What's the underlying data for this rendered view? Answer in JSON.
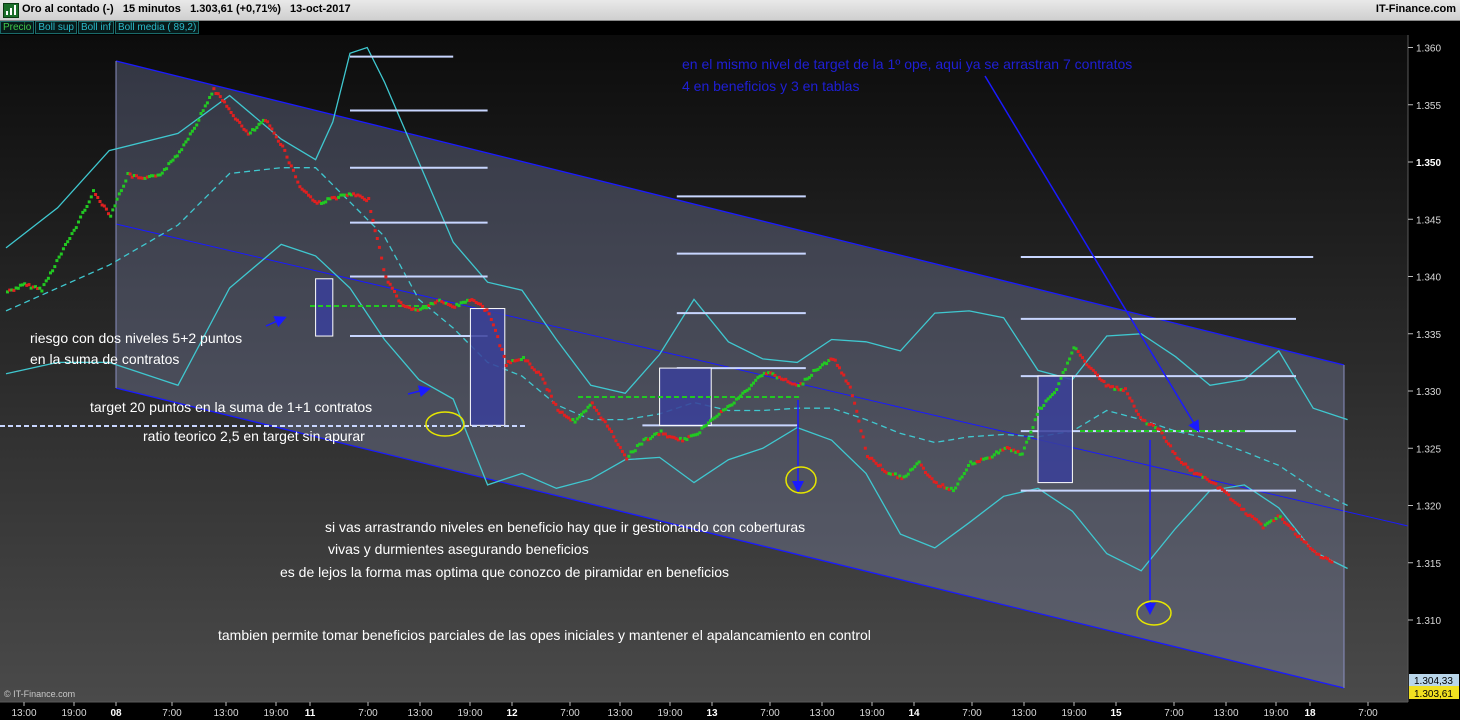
{
  "window": {
    "title": "Oro al contado (-)   15 minutos   1.303,61 (+0,71%)   13-oct-2017",
    "brand": "IT-Finance.com"
  },
  "legend": [
    "Precio",
    "Boll sup",
    "Boll inf",
    "Boll media ( 89,2)"
  ],
  "footer": "© IT-Finance.com",
  "colors": {
    "background": "#000000",
    "bands": "#3fc8d0",
    "channel": "#1a1aff",
    "up": "#22c922",
    "down": "#e02020",
    "levels": "#c8d6ff",
    "boxes": "#3a3f9a",
    "annotation_blue": "#1f1fd6",
    "ellipse": "#e6e600"
  },
  "chart_data": {
    "type": "scatter",
    "title": "Oro al contado (-)",
    "timeframe": "15 minutos",
    "last_price": "1.303,61",
    "change": "+0,71%",
    "date": "13-oct-2017",
    "price_labels": [
      "1.304,33",
      "1.303,61"
    ],
    "yticks": [
      "1.310",
      "1.315",
      "1.320",
      "1.325",
      "1.330",
      "1.335",
      "1.340",
      "1.345",
      "1.350",
      "1.355",
      "1.360"
    ],
    "ylim": [
      1306.5,
      1362
    ],
    "xticks": [
      "13:00",
      "19:00",
      "08",
      "7:00",
      "13:00",
      "19:00",
      "11",
      "7:00",
      "13:00",
      "19:00",
      "12",
      "7:00",
      "13:00",
      "19:00",
      "13",
      "7:00",
      "13:00",
      "19:00",
      "14",
      "7:00",
      "13:00",
      "19:00",
      "15",
      "7:00",
      "13:00",
      "19:00",
      "18",
      "7:00"
    ],
    "xtick_bold": [
      "08",
      "11",
      "12",
      "13",
      "14",
      "15",
      "18"
    ],
    "series": [
      {
        "name": "Precio",
        "points": [
          [
            0,
            1338.8
          ],
          [
            4,
            1339.4
          ],
          [
            8,
            1339.0
          ],
          [
            12,
            1341.8
          ],
          [
            16,
            1344.5
          ],
          [
            20,
            1347.5
          ],
          [
            24,
            1345.5
          ],
          [
            28,
            1349.0
          ],
          [
            32,
            1348.6
          ],
          [
            36,
            1349.2
          ],
          [
            40,
            1351.0
          ],
          [
            44,
            1353.5
          ],
          [
            48,
            1356.5
          ],
          [
            52,
            1354.5
          ],
          [
            56,
            1352.5
          ],
          [
            60,
            1353.8
          ],
          [
            64,
            1351.5
          ],
          [
            68,
            1348.0
          ],
          [
            72,
            1346.5
          ],
          [
            76,
            1347.0
          ],
          [
            80,
            1347.3
          ],
          [
            84,
            1346.8
          ],
          [
            88,
            1340.0
          ],
          [
            92,
            1337.5
          ],
          [
            96,
            1337.2
          ],
          [
            100,
            1338.0
          ],
          [
            104,
            1337.5
          ],
          [
            108,
            1338.2
          ],
          [
            112,
            1337.0
          ],
          [
            116,
            1332.5
          ],
          [
            120,
            1333.0
          ],
          [
            124,
            1331.5
          ],
          [
            128,
            1328.5
          ],
          [
            132,
            1327.4
          ],
          [
            136,
            1329.0
          ],
          [
            140,
            1326.8
          ],
          [
            144,
            1324.3
          ],
          [
            148,
            1325.8
          ],
          [
            152,
            1326.5
          ],
          [
            156,
            1325.8
          ],
          [
            160,
            1326.2
          ],
          [
            164,
            1327.8
          ],
          [
            168,
            1328.8
          ],
          [
            172,
            1330.2
          ],
          [
            176,
            1331.8
          ],
          [
            180,
            1331.2
          ],
          [
            184,
            1330.5
          ],
          [
            188,
            1332.0
          ],
          [
            192,
            1333.0
          ],
          [
            196,
            1330.5
          ],
          [
            200,
            1324.5
          ],
          [
            204,
            1323.2
          ],
          [
            208,
            1322.5
          ],
          [
            212,
            1323.8
          ],
          [
            216,
            1322.0
          ],
          [
            220,
            1321.5
          ],
          [
            224,
            1323.8
          ],
          [
            228,
            1324.2
          ],
          [
            232,
            1325.2
          ],
          [
            236,
            1324.6
          ],
          [
            240,
            1328.5
          ],
          [
            244,
            1330.2
          ],
          [
            248,
            1334.0
          ],
          [
            252,
            1332.0
          ],
          [
            256,
            1330.5
          ],
          [
            260,
            1330.2
          ],
          [
            264,
            1327.5
          ],
          [
            268,
            1326.8
          ],
          [
            272,
            1324.3
          ],
          [
            276,
            1323.0
          ],
          [
            280,
            1322.2
          ],
          [
            284,
            1321.0
          ],
          [
            288,
            1319.5
          ],
          [
            292,
            1318.3
          ],
          [
            296,
            1319.2
          ],
          [
            300,
            1317.5
          ],
          [
            304,
            1316.0
          ],
          [
            308,
            1315.2
          ]
        ]
      },
      {
        "name": "Boll sup",
        "points": [
          [
            0,
            1342.5
          ],
          [
            12,
            1346.0
          ],
          [
            24,
            1351.0
          ],
          [
            40,
            1352.5
          ],
          [
            52,
            1355.8
          ],
          [
            64,
            1352.0
          ],
          [
            72,
            1350.2
          ],
          [
            76,
            1353.5
          ],
          [
            80,
            1359.5
          ],
          [
            84,
            1360.0
          ],
          [
            88,
            1357.0
          ],
          [
            96,
            1350.0
          ],
          [
            104,
            1343.0
          ],
          [
            112,
            1339.5
          ],
          [
            120,
            1338.8
          ],
          [
            128,
            1334.5
          ],
          [
            136,
            1330.5
          ],
          [
            144,
            1329.8
          ],
          [
            152,
            1333.2
          ],
          [
            160,
            1338.0
          ],
          [
            168,
            1334.3
          ],
          [
            176,
            1332.8
          ],
          [
            184,
            1332.5
          ],
          [
            192,
            1334.5
          ],
          [
            200,
            1334.3
          ],
          [
            208,
            1333.5
          ],
          [
            216,
            1336.8
          ],
          [
            224,
            1337.0
          ],
          [
            232,
            1336.4
          ],
          [
            240,
            1331.8
          ],
          [
            248,
            1331.0
          ],
          [
            256,
            1334.8
          ],
          [
            264,
            1335.0
          ],
          [
            272,
            1333.0
          ],
          [
            280,
            1330.5
          ],
          [
            288,
            1331.0
          ],
          [
            296,
            1333.5
          ],
          [
            300,
            1331.0
          ],
          [
            304,
            1328.5
          ],
          [
            312,
            1327.5
          ]
        ]
      },
      {
        "name": "Boll inf",
        "points": [
          [
            0,
            1331.5
          ],
          [
            12,
            1332.5
          ],
          [
            24,
            1332.5
          ],
          [
            40,
            1330.5
          ],
          [
            52,
            1339.0
          ],
          [
            64,
            1342.8
          ],
          [
            72,
            1341.8
          ],
          [
            80,
            1339.0
          ],
          [
            88,
            1334.5
          ],
          [
            96,
            1331.0
          ],
          [
            104,
            1329.3
          ],
          [
            112,
            1321.8
          ],
          [
            120,
            1322.8
          ],
          [
            128,
            1321.5
          ],
          [
            136,
            1322.3
          ],
          [
            144,
            1324.0
          ],
          [
            152,
            1324.2
          ],
          [
            160,
            1322.0
          ],
          [
            168,
            1324.0
          ],
          [
            176,
            1325.0
          ],
          [
            184,
            1326.8
          ],
          [
            192,
            1325.7
          ],
          [
            200,
            1322.8
          ],
          [
            208,
            1317.5
          ],
          [
            216,
            1316.3
          ],
          [
            224,
            1318.5
          ],
          [
            232,
            1320.8
          ],
          [
            240,
            1321.5
          ],
          [
            248,
            1319.5
          ],
          [
            256,
            1315.8
          ],
          [
            264,
            1314.3
          ],
          [
            272,
            1318.0
          ],
          [
            280,
            1321.3
          ],
          [
            288,
            1321.8
          ],
          [
            296,
            1319.8
          ],
          [
            304,
            1316.0
          ],
          [
            312,
            1314.5
          ]
        ]
      },
      {
        "name": "Boll media",
        "points": [
          [
            0,
            1337.0
          ],
          [
            12,
            1339.0
          ],
          [
            24,
            1341.0
          ],
          [
            40,
            1344.5
          ],
          [
            52,
            1349.0
          ],
          [
            64,
            1349.5
          ],
          [
            72,
            1349.5
          ],
          [
            80,
            1346.5
          ],
          [
            88,
            1343.5
          ],
          [
            96,
            1338.0
          ],
          [
            104,
            1335.5
          ],
          [
            112,
            1332.5
          ],
          [
            120,
            1331.3
          ],
          [
            128,
            1328.8
          ],
          [
            136,
            1327.5
          ],
          [
            144,
            1327.5
          ],
          [
            152,
            1328.0
          ],
          [
            160,
            1329.0
          ],
          [
            168,
            1328.3
          ],
          [
            176,
            1328.3
          ],
          [
            184,
            1328.5
          ],
          [
            192,
            1328.5
          ],
          [
            200,
            1327.5
          ],
          [
            208,
            1326.3
          ],
          [
            216,
            1325.5
          ],
          [
            224,
            1326.0
          ],
          [
            232,
            1326.2
          ],
          [
            240,
            1326.0
          ],
          [
            248,
            1326.5
          ],
          [
            256,
            1328.3
          ],
          [
            264,
            1327.5
          ],
          [
            272,
            1326.5
          ],
          [
            280,
            1325.8
          ],
          [
            288,
            1324.7
          ],
          [
            296,
            1323.5
          ],
          [
            304,
            1321.5
          ],
          [
            312,
            1320.0
          ]
        ]
      }
    ],
    "levels": [
      {
        "x": [
          80,
          104
        ],
        "y": 1359.2
      },
      {
        "x": [
          80,
          112
        ],
        "y": 1354.5
      },
      {
        "x": [
          80,
          112
        ],
        "y": 1349.5
      },
      {
        "x": [
          80,
          112
        ],
        "y": 1344.7
      },
      {
        "x": [
          80,
          112
        ],
        "y": 1340.0
      },
      {
        "x": [
          80,
          112
        ],
        "y": 1334.8
      },
      {
        "x": [
          156,
          186
        ],
        "y": 1347.0
      },
      {
        "x": [
          156,
          186
        ],
        "y": 1342.0
      },
      {
        "x": [
          156,
          186
        ],
        "y": 1336.8
      },
      {
        "x": [
          156,
          186
        ],
        "y": 1332.0
      },
      {
        "x": [
          148,
          184
        ],
        "y": 1327.0
      },
      {
        "x": [
          236,
          304
        ],
        "y": 1341.7
      },
      {
        "x": [
          236,
          300
        ],
        "y": 1336.3
      },
      {
        "x": [
          236,
          300
        ],
        "y": 1331.3
      },
      {
        "x": [
          236,
          300
        ],
        "y": 1326.5
      },
      {
        "x": [
          236,
          300
        ],
        "y": 1321.3
      }
    ],
    "boxes": [
      {
        "x": [
          72,
          76
        ],
        "y": [
          1334.8,
          1339.8
        ]
      },
      {
        "x": [
          108,
          116
        ],
        "y": [
          1327.0,
          1337.2
        ]
      },
      {
        "x": [
          152,
          164
        ],
        "y": [
          1327.0,
          1332.0
        ]
      },
      {
        "x": [
          240,
          248
        ],
        "y": [
          1322.0,
          1331.3
        ]
      }
    ],
    "annotations": [
      "riesgo con dos niveles 5+2 puntos",
      "en la suma de contratos",
      "target 20 puntos en la suma de 1+1  contratos",
      "ratio teorico 2,5 en target sin apurar",
      "si vas arrastrando niveles en beneficio hay que ir gestionando con coberturas",
      "vivas y durmientes asegurando beneficios",
      "es de lejos la forma mas optima que conozco de piramidar en beneficios",
      "tambien permite tomar beneficios parciales de las opes iniciales y mantener el apalancamiento en control",
      "en el mismo nivel de target de la 1º ope, aqui  ya se arrastran  7 contratos",
      " 4 en beneficios y 3 en tablas"
    ]
  }
}
